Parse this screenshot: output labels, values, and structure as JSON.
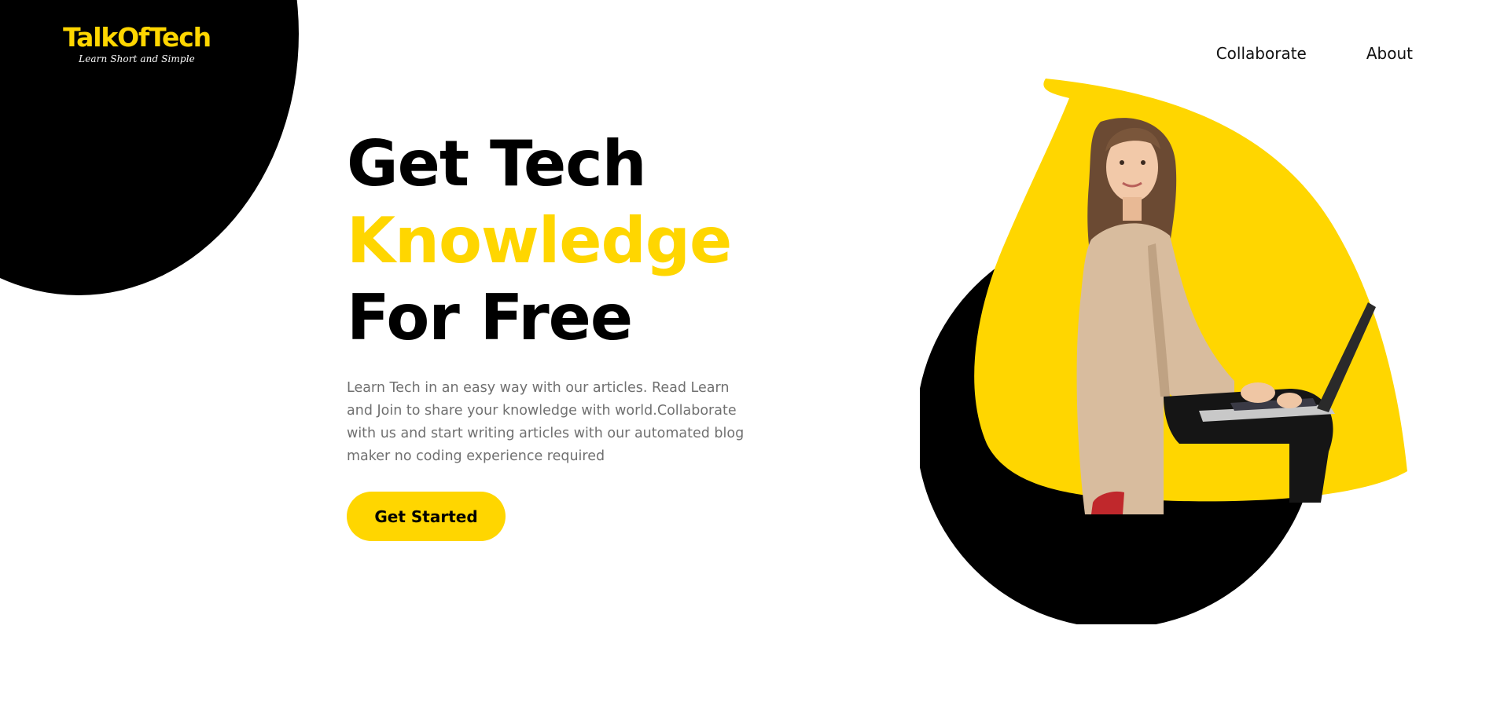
{
  "logo": {
    "title": "TalkOfTech",
    "tagline": "Learn Short and Simple"
  },
  "nav": {
    "collaborate": "Collaborate",
    "about": "About"
  },
  "hero": {
    "line1": "Get Tech",
    "line2": "Knowledge",
    "line3": "For Free",
    "description": "Learn Tech in an easy way with our articles. Read Learn and Join to share your knowledge with world.Collaborate with us and start writing articles with our automated blog maker no coding experience required",
    "cta_label": "Get Started"
  },
  "colors": {
    "accent": "#ffd600",
    "dark": "#000000",
    "body_text": "#707070"
  },
  "illustration": {
    "subject": "woman-with-laptop"
  }
}
